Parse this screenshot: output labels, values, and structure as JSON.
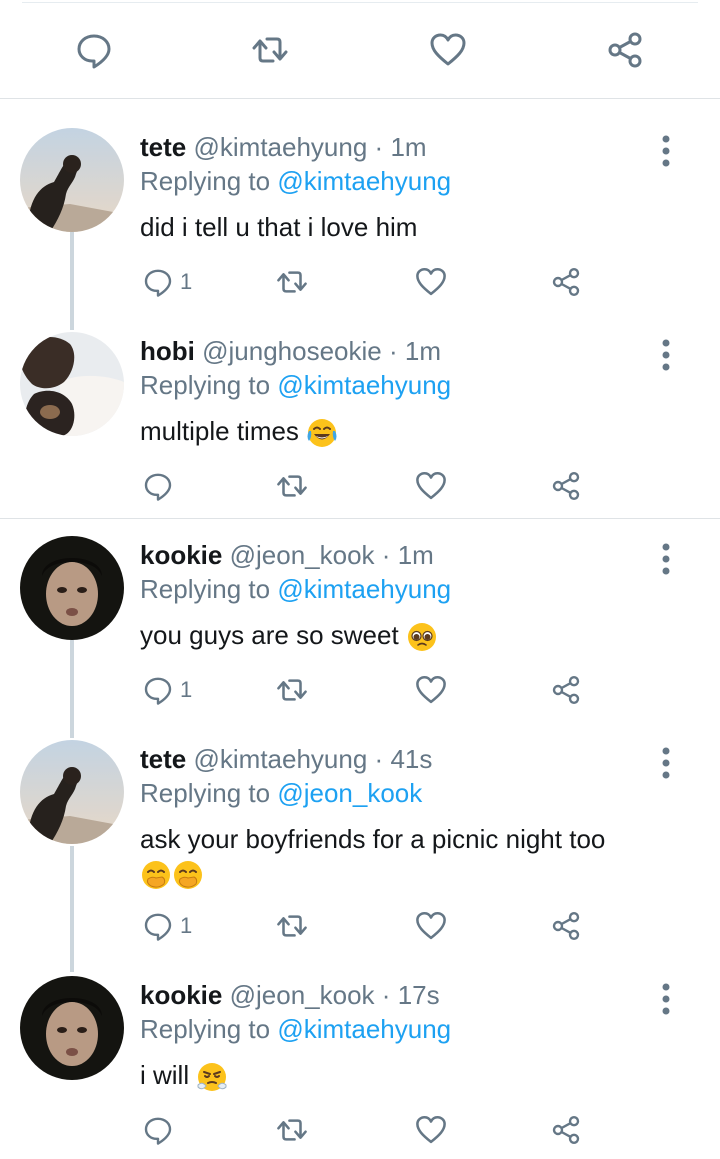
{
  "top_actions": {
    "reply_icon": "speech-bubble-icon",
    "retweet_icon": "retweet-icon",
    "like_icon": "heart-icon",
    "share_icon": "share-icon"
  },
  "tweets": [
    {
      "name": "tete",
      "handle": "@kimtaehyung",
      "dot": "·",
      "time": "1m",
      "replying_prefix": "Replying to",
      "replying_to": "@kimtaehyung",
      "text": "did i tell u that i love him",
      "reply_count": "1"
    },
    {
      "name": "hobi",
      "handle": "@junghoseokie",
      "dot": "·",
      "time": "1m",
      "replying_prefix": "Replying to",
      "replying_to": "@kimtaehyung",
      "text": "multiple times",
      "emoji": "face-with-tears-of-joy",
      "reply_count": ""
    },
    {
      "name": "kookie",
      "handle": "@jeon_kook",
      "dot": "·",
      "time": "1m",
      "replying_prefix": "Replying to",
      "replying_to": "@kimtaehyung",
      "text": "you guys are so sweet",
      "emoji": "pleading-face",
      "reply_count": "1"
    },
    {
      "name": "tete",
      "handle": "@kimtaehyung",
      "dot": "·",
      "time": "41s",
      "replying_prefix": "Replying to",
      "replying_to": "@jeon_kook",
      "text": "ask your boyfriends for a picnic night too",
      "emoji": "face-with-hand-over-mouth",
      "reply_count": "1"
    },
    {
      "name": "kookie",
      "handle": "@jeon_kook",
      "dot": "·",
      "time": "17s",
      "replying_prefix": "Replying to",
      "replying_to": "@kimtaehyung",
      "text": "i will",
      "emoji": "face-with-steam-from-nose",
      "reply_count": ""
    }
  ],
  "colors": {
    "link": "#1da1f2",
    "secondary": "#657786",
    "thread_line": "#ccd6dd"
  }
}
